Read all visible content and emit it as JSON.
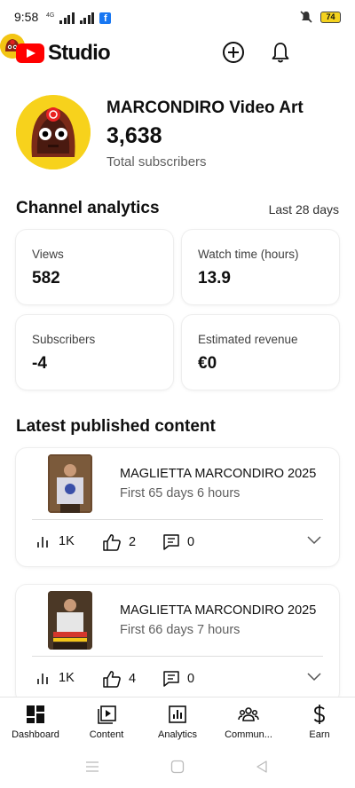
{
  "status_bar": {
    "time": "9:58",
    "network_label": "4G",
    "facebook_badge": "f",
    "battery": "74"
  },
  "app": {
    "logo_text": "Studio",
    "brand_color": "#ff0000"
  },
  "channel": {
    "name": "MARCONDIRO Video Art",
    "subscribers": "3,638",
    "subscribers_label": "Total subscribers"
  },
  "analytics": {
    "title": "Channel analytics",
    "period": "Last 28 days",
    "cards": [
      {
        "label": "Views",
        "value": "582"
      },
      {
        "label": "Watch time (hours)",
        "value": "13.9"
      },
      {
        "label": "Subscribers",
        "value": "-4"
      },
      {
        "label": "Estimated revenue",
        "value": "€0"
      }
    ]
  },
  "latest": {
    "title": "Latest published content",
    "items": [
      {
        "title": "MAGLIETTA MARCONDIRO 2025",
        "subtitle": "First 65 days 6 hours",
        "views": "1K",
        "likes": "2",
        "comments": "0"
      },
      {
        "title": "MAGLIETTA MARCONDIRO 2025",
        "subtitle": "First 66 days 7 hours",
        "views": "1K",
        "likes": "4",
        "comments": "0"
      }
    ]
  },
  "bottom_nav": [
    {
      "label": "Dashboard",
      "icon": "dashboard-icon"
    },
    {
      "label": "Content",
      "icon": "content-icon"
    },
    {
      "label": "Analytics",
      "icon": "analytics-icon"
    },
    {
      "label": "Commun...",
      "icon": "community-icon"
    },
    {
      "label": "Earn",
      "icon": "dollar-icon"
    }
  ]
}
